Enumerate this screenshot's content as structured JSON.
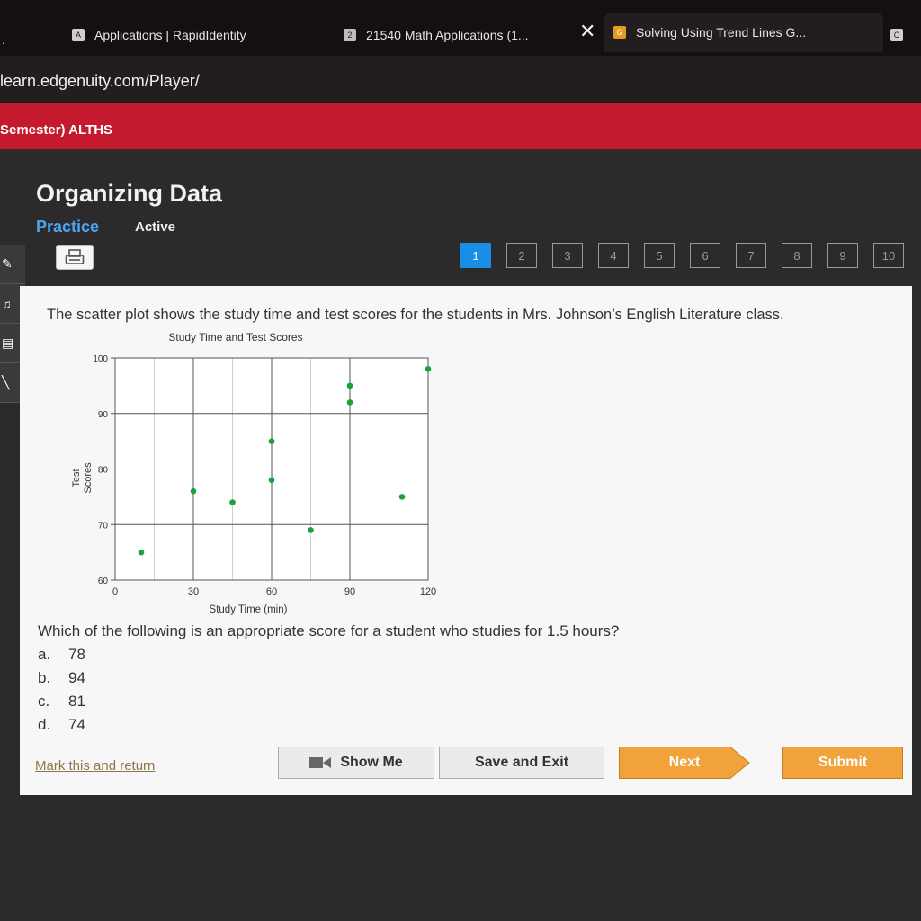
{
  "browser": {
    "tabs": [
      {
        "badge": "A",
        "label": "Applications | RapidIdentity"
      },
      {
        "badge": "2",
        "label": "21540 Math Applications (1..."
      },
      {
        "badge": "G",
        "label": "Solving Using Trend Lines G..."
      },
      {
        "badge": "C",
        "label": "C"
      }
    ],
    "url": "learn.edgenuity.com/Player/"
  },
  "app": {
    "course": "Semester) ALTHS",
    "lesson_title": "Organizing Data",
    "mode_practice": "Practice",
    "mode_active": "Active",
    "pages": [
      "1",
      "2",
      "3",
      "4",
      "5",
      "6",
      "7",
      "8",
      "9",
      "10"
    ],
    "current_page": "1"
  },
  "question": {
    "text": "The scatter plot shows the study time and test scores for the students in Mrs. Johnson’s English Literature class.",
    "prompt": "Which of the following is an appropriate score for a student who studies for 1.5 hours?",
    "choices": [
      {
        "letter": "a.",
        "value": "78"
      },
      {
        "letter": "b.",
        "value": "94"
      },
      {
        "letter": "c.",
        "value": "81"
      },
      {
        "letter": "d.",
        "value": "74"
      }
    ]
  },
  "footer": {
    "mark_return": "Mark this and return",
    "show_me": "Show Me",
    "save_exit": "Save and Exit",
    "next": "Next",
    "submit": "Submit"
  },
  "colors": {
    "brand_red": "#c4192e",
    "accent_blue": "#1a8de6",
    "button_orange": "#f2a23a",
    "point_green": "#1aa33a"
  },
  "chart_data": {
    "type": "scatter",
    "title": "Study Time and Test Scores",
    "xlabel": "Study Time (min)",
    "ylabel": "Test Scores",
    "xlim": [
      0,
      120
    ],
    "ylim": [
      60,
      100
    ],
    "xticks": [
      0,
      30,
      60,
      90,
      120
    ],
    "yticks": [
      60,
      70,
      80,
      90,
      100
    ],
    "grid": true,
    "series": [
      {
        "points": [
          [
            10,
            65
          ],
          [
            30,
            76
          ],
          [
            45,
            74
          ],
          [
            60,
            85
          ],
          [
            60,
            78
          ],
          [
            75,
            69
          ],
          [
            90,
            95
          ],
          [
            90,
            92
          ],
          [
            110,
            75
          ],
          [
            120,
            98
          ]
        ]
      }
    ]
  }
}
